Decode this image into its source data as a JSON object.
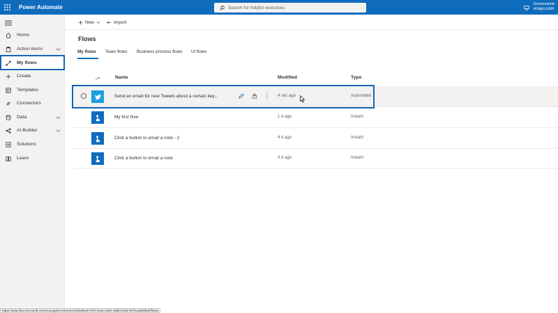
{
  "app": {
    "title": "Power Automate"
  },
  "search": {
    "placeholder": "Search for helpful resources"
  },
  "environment": {
    "label": "Environments",
    "name": "enayu.com"
  },
  "sidebar": {
    "items": [
      {
        "label": "Home",
        "icon": "home-icon"
      },
      {
        "label": "Action items",
        "icon": "clipboard-icon",
        "expandable": true
      },
      {
        "label": "My flows",
        "icon": "flow-icon",
        "selected": true
      },
      {
        "label": "Create",
        "icon": "plus-icon"
      },
      {
        "label": "Templates",
        "icon": "templates-icon"
      },
      {
        "label": "Connectors",
        "icon": "connectors-icon"
      },
      {
        "label": "Data",
        "icon": "database-icon",
        "expandable": true
      },
      {
        "label": "AI Builder",
        "icon": "ai-builder-icon",
        "expandable": true
      },
      {
        "label": "Solutions",
        "icon": "solutions-icon"
      },
      {
        "label": "Learn",
        "icon": "book-icon"
      }
    ]
  },
  "commands": {
    "new_label": "New",
    "import_label": "Import"
  },
  "page": {
    "title": "Flows"
  },
  "tabs": [
    {
      "label": "My flows",
      "active": true
    },
    {
      "label": "Team flows"
    },
    {
      "label": "Business process flows"
    },
    {
      "label": "UI flows"
    }
  ],
  "table": {
    "headers": {
      "name": "Name",
      "modified": "Modified",
      "type": "Type"
    },
    "rows": [
      {
        "name": "Send an email for new Tweets about a certain key...",
        "modified": "4 sec ago",
        "type": "Automated",
        "icon": "twitter-icon"
      },
      {
        "name": "My first flow",
        "modified": "1 d ago",
        "type": "Instant",
        "icon": "touch-icon"
      },
      {
        "name": "Click a button to email a note - 2",
        "modified": "4 d ago",
        "type": "Instant",
        "icon": "touch-icon"
      },
      {
        "name": "Click a button to email a note",
        "modified": "4 d ago",
        "type": "Instant",
        "icon": "touch-icon"
      }
    ]
  },
  "status": {
    "url": "https://asia.flow.microsoft.com/manage/environments/Default-37574ca6-cde8-4d8b-bcb6-097b1a5d8b63/flows"
  },
  "colors": {
    "brand": "#0f6cbd",
    "highlight": "#1267b4",
    "twitter": "#1b9de2"
  }
}
